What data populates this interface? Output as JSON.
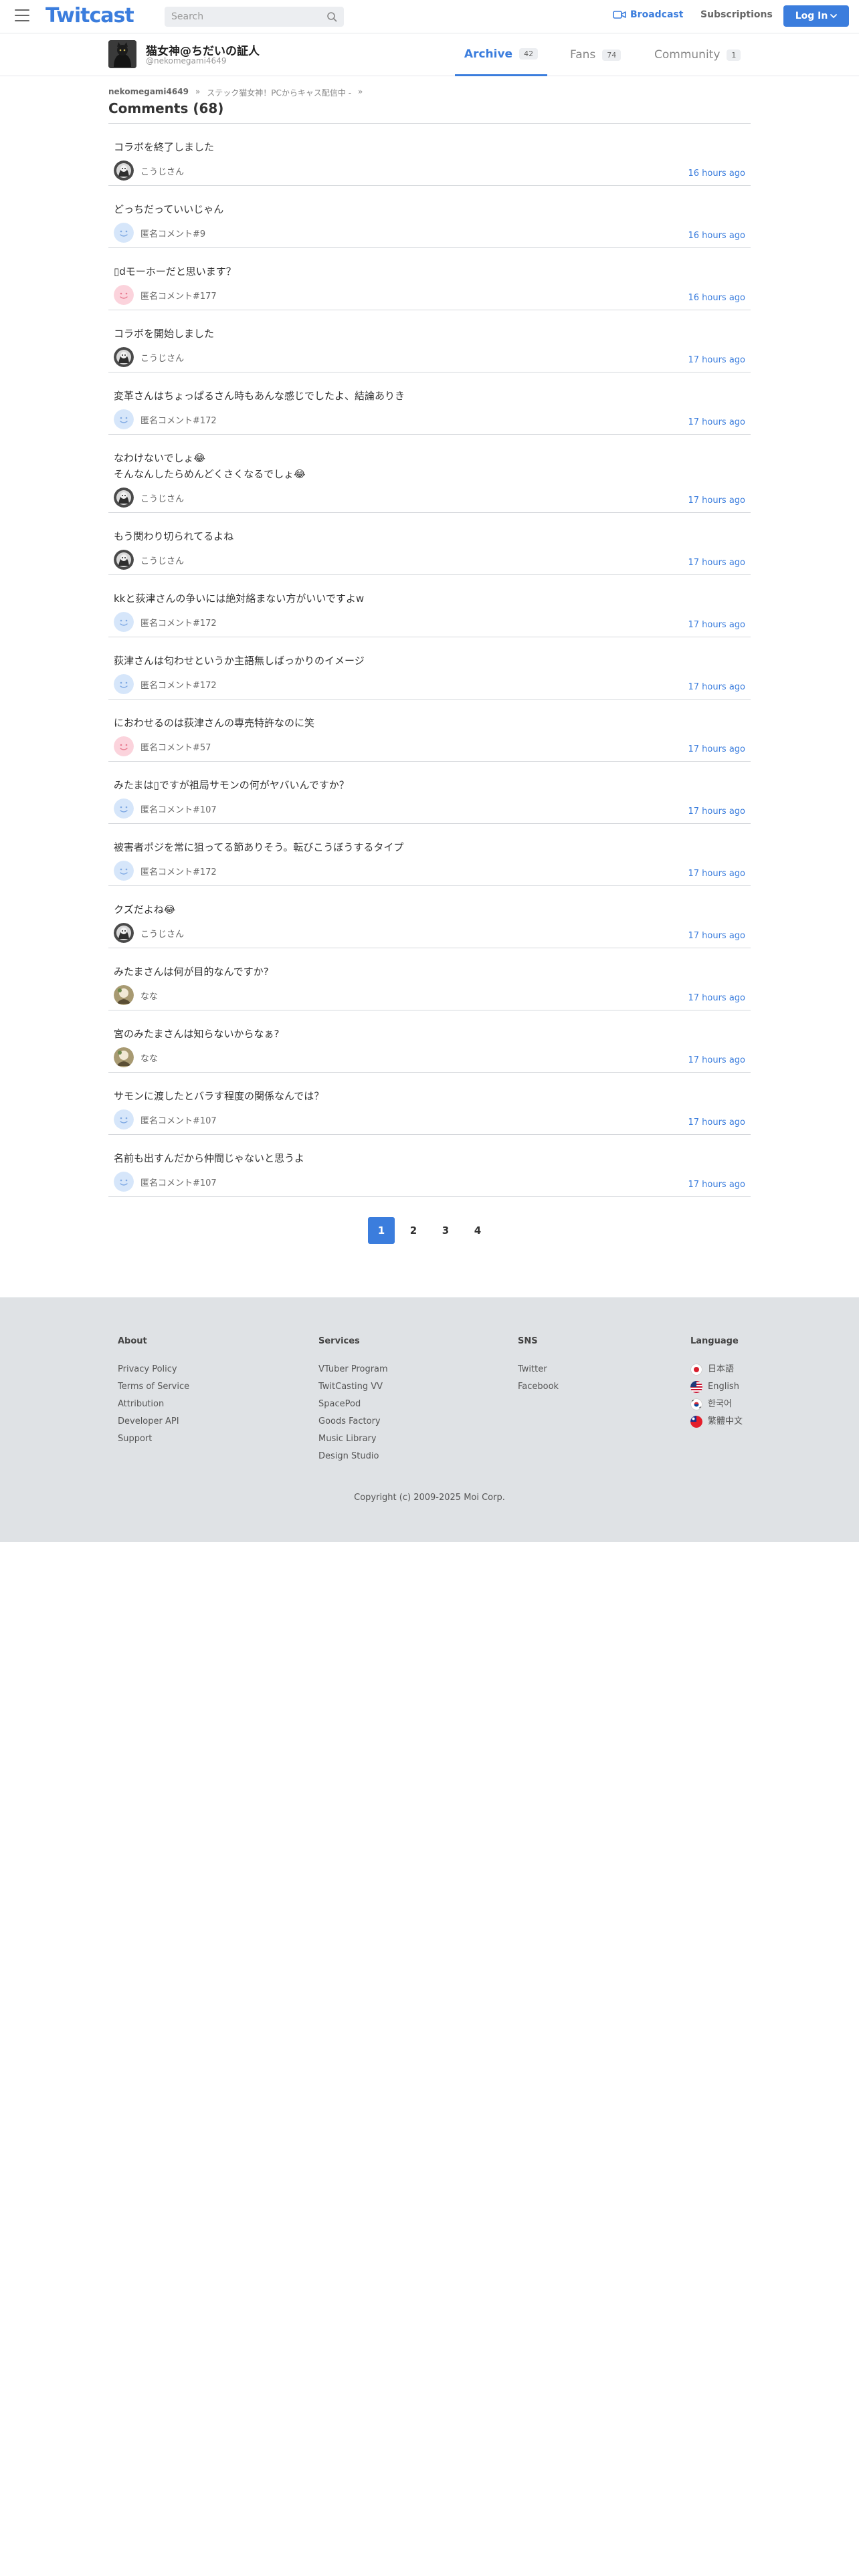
{
  "header": {
    "logo": "Twitcast",
    "search_placeholder": "Search",
    "broadcast_label": "Broadcast",
    "subscriptions_label": "Subscriptions",
    "login_label": "Log In",
    "accent_color": "#3b7ddd"
  },
  "user": {
    "name": "猫女神@ちだいの証人",
    "handle": "@nekomegami4649"
  },
  "tabs": [
    {
      "label": "Archive",
      "count": "42"
    },
    {
      "label": "Fans",
      "count": "74"
    },
    {
      "label": "Community",
      "count": "1"
    }
  ],
  "breadcrumb": {
    "user": "nekomegami4649",
    "sep1": "»",
    "movie": "ステック猫女神！PCからキャス配信中 -",
    "sep2": "»"
  },
  "page_title": "Comments (68)",
  "comments": [
    {
      "text": "コラボを終了しました",
      "author": "こうじさん",
      "avatar": "dark",
      "time": "16 hours ago"
    },
    {
      "text": "どっちだっていいじゃん",
      "author": "匿名コメント#9",
      "avatar": "blue",
      "time": "16 hours ago"
    },
    {
      "text": "▯dモーホーだと思います？",
      "author": "匿名コメント#177",
      "avatar": "pink",
      "time": "16 hours ago"
    },
    {
      "text": "コラボを開始しました",
      "author": "こうじさん",
      "avatar": "dark",
      "time": "17 hours ago"
    },
    {
      "text": "変革さんはちょっぱるさん時もあんな感じでしたよ、結論ありき",
      "author": "匿名コメント#172",
      "avatar": "blue",
      "time": "17 hours ago"
    },
    {
      "text": "なわけないでしょ😂\nそんなんしたらめんどくさくなるでしょ😂",
      "author": "こうじさん",
      "avatar": "dark",
      "time": "17 hours ago"
    },
    {
      "text": "もう関わり切られてるよね",
      "author": "こうじさん",
      "avatar": "dark",
      "time": "17 hours ago"
    },
    {
      "text": "kkと荻津さんの争いには絶対絡まない方がいいですよw",
      "author": "匿名コメント#172",
      "avatar": "blue",
      "time": "17 hours ago"
    },
    {
      "text": "荻津さんは匂わせというか主語無しばっかりのイメージ",
      "author": "匿名コメント#172",
      "avatar": "blue",
      "time": "17 hours ago"
    },
    {
      "text": "におわせるのは荻津さんの専売特許なのに笑",
      "author": "匿名コメント#57",
      "avatar": "pink",
      "time": "17 hours ago"
    },
    {
      "text": "みたまは▯ですが祖局サモンの何がヤバいんですか？",
      "author": "匿名コメント#107",
      "avatar": "blue",
      "time": "17 hours ago"
    },
    {
      "text": "被害者ポジを常に狙ってる節ありそう。転びこうぼうするタイプ",
      "author": "匿名コメント#172",
      "avatar": "blue",
      "time": "17 hours ago"
    },
    {
      "text": "クズだよね😂",
      "author": "こうじさん",
      "avatar": "dark",
      "time": "17 hours ago"
    },
    {
      "text": "みたまさんは何が目的なんですか?",
      "author": "なな",
      "avatar": "photo",
      "time": "17 hours ago"
    },
    {
      "text": "宮のみたまさんは知らないからなぁ?",
      "author": "なな",
      "avatar": "photo",
      "time": "17 hours ago"
    },
    {
      "text": "サモンに渡したとバラす程度の関係なんでは？",
      "author": "匿名コメント#107",
      "avatar": "blue",
      "time": "17 hours ago"
    },
    {
      "text": "名前も出すんだから仲間じゃないと思うよ",
      "author": "匿名コメント#107",
      "avatar": "blue",
      "time": "17 hours ago"
    }
  ],
  "pagination": {
    "pages": [
      "1",
      "2",
      "3",
      "4"
    ],
    "current": "1"
  },
  "footer": {
    "about": {
      "heading": "About",
      "links": [
        "Privacy Policy",
        "Terms of Service",
        "Attribution",
        "Developer API",
        "Support"
      ]
    },
    "services": {
      "heading": "Services",
      "links": [
        "VTuber Program",
        "TwitCasting VV",
        "SpacePod",
        "Goods Factory",
        "Music Library",
        "Design Studio"
      ]
    },
    "sns": {
      "heading": "SNS",
      "links": [
        "Twitter",
        "Facebook"
      ]
    },
    "language": {
      "heading": "Language",
      "links": [
        {
          "label": "日本語",
          "flag": "jp-flag-icon"
        },
        {
          "label": "English",
          "flag": "us-flag-icon"
        },
        {
          "label": "한국어",
          "flag": "kr-flag-icon"
        },
        {
          "label": "繁體中文",
          "flag": "tw-flag-icon"
        }
      ]
    },
    "copyright": "Copyright (c) 2009-2025 Moi Corp."
  }
}
